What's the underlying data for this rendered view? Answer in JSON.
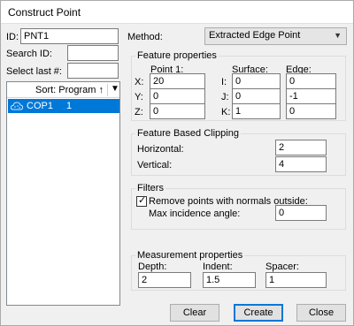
{
  "window": {
    "title": "Construct Point"
  },
  "left": {
    "id_label": "ID:",
    "id_value": "PNT1",
    "search_label": "Search ID:",
    "search_value": "",
    "select_last_label": "Select last #:",
    "select_last_value": "",
    "sort_label": "Sort: Program ↑",
    "items": [
      {
        "name": "COP1",
        "number": "1",
        "icon": "cloud-points-icon"
      }
    ]
  },
  "method": {
    "label": "Method:",
    "value": "Extracted Edge Point"
  },
  "feature_properties": {
    "title": "Feature properties",
    "point_header": "Point 1:",
    "surface_header": "Surface:",
    "edge_header": "Edge:",
    "rows": [
      {
        "axis": "X:",
        "point": "20",
        "surface_axis": "I:",
        "surface": "0",
        "edge": "0"
      },
      {
        "axis": "Y:",
        "point": "0",
        "surface_axis": "J:",
        "surface": "0",
        "edge": "-1"
      },
      {
        "axis": "Z:",
        "point": "0",
        "surface_axis": "K:",
        "surface": "1",
        "edge": "0"
      }
    ]
  },
  "clipping": {
    "title": "Feature Based Clipping",
    "horizontal_label": "Horizontal:",
    "horizontal_value": "2",
    "vertical_label": "Vertical:",
    "vertical_value": "4"
  },
  "filters": {
    "title": "Filters",
    "remove_label": "Remove points with normals outside:",
    "remove_checked": true,
    "max_angle_label": "Max incidence angle:",
    "max_angle_value": "0"
  },
  "measurement": {
    "title": "Measurement properties",
    "depth_label": "Depth:",
    "depth_value": "2",
    "indent_label": "Indent:",
    "indent_value": "1.5",
    "spacer_label": "Spacer:",
    "spacer_value": "1"
  },
  "buttons": {
    "clear": "Clear",
    "create": "Create",
    "close": "Close"
  }
}
